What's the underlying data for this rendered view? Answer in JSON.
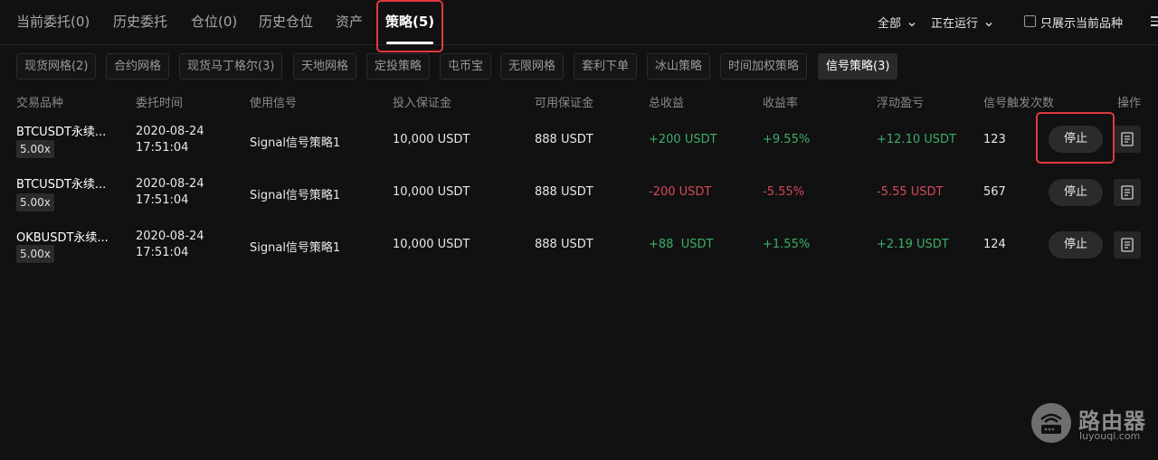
{
  "nav": {
    "tabs": [
      {
        "label": "当前委托(0)"
      },
      {
        "label": "历史委托"
      },
      {
        "label": "仓位(0)"
      },
      {
        "label": "历史仓位"
      },
      {
        "label": "资产"
      },
      {
        "label": "策略(5)",
        "active": true
      }
    ],
    "filter_all": "全部",
    "filter_status": "正在运行",
    "only_current_label": "只展示当前品种"
  },
  "chips": [
    {
      "label": "现货网格(2)"
    },
    {
      "label": "合约网格"
    },
    {
      "label": "现货马丁格尔(3)"
    },
    {
      "label": "天地网格"
    },
    {
      "label": "定投策略"
    },
    {
      "label": "屯币宝"
    },
    {
      "label": "无限网格"
    },
    {
      "label": "套利下单"
    },
    {
      "label": "冰山策略"
    },
    {
      "label": "时间加权策略"
    },
    {
      "label": "信号策略(3)",
      "active": true
    }
  ],
  "table": {
    "headers": [
      "交易品种",
      "委托时间",
      "使用信号",
      "投入保证金",
      "可用保证金",
      "总收益",
      "收益率",
      "浮动盈亏",
      "信号触发次数",
      "操作"
    ],
    "rows": [
      {
        "symbol": "BTCUSDT永续...",
        "leverage": "5.00x",
        "date": "2020-08-24",
        "time": "17:51:04",
        "signal": "Signal信号策略1",
        "invested": "10,000 USDT",
        "available": "888 USDT",
        "total_profit": "+200 USDT",
        "rate": "+9.55%",
        "floating": "+12.10 USDT",
        "triggers": "123",
        "action": "停止",
        "sign": "pos"
      },
      {
        "symbol": "BTCUSDT永续...",
        "leverage": "5.00x",
        "date": "2020-08-24",
        "time": "17:51:04",
        "signal": "Signal信号策略1",
        "invested": "10,000 USDT",
        "available": "888 USDT",
        "total_profit": "-200 USDT",
        "rate": "-5.55%",
        "floating": "-5.55 USDT",
        "triggers": "567",
        "action": "停止",
        "sign": "neg"
      },
      {
        "symbol": "OKBUSDT永续...",
        "leverage": "5.00x",
        "date": "2020-08-24",
        "time": "17:51:04",
        "signal": "Signal信号策略1",
        "invested": "10,000 USDT",
        "available": "888 USDT",
        "total_profit": "+88  USDT",
        "rate": "+1.55%",
        "floating": "+2.19 USDT",
        "triggers": "124",
        "action": "停止",
        "sign": "pos"
      }
    ]
  },
  "watermark": {
    "title": "路由器",
    "url": "luyouqi.com"
  },
  "colors": {
    "background": "#111111",
    "positive": "#3dae6a",
    "negative": "#d4485a",
    "highlight": "#e0393e"
  },
  "icons": [
    "chevron-down-icon",
    "document-icon",
    "menu-icon"
  ]
}
